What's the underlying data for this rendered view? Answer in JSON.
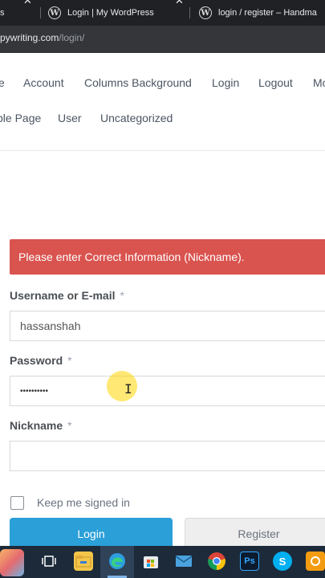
{
  "browser": {
    "tabs": [
      {
        "label": "s"
      },
      {
        "label": "Login | My WordPress"
      },
      {
        "label": "login / register – Handma"
      }
    ],
    "url_host": "pywriting.com",
    "url_path": "/login/"
  },
  "nav": {
    "row1": [
      "e",
      "Account",
      "Columns Background",
      "Login",
      "Logout",
      "Mo"
    ],
    "row2": [
      "ble Page",
      "User",
      "Uncategorized"
    ]
  },
  "alert": {
    "message": "Please enter Correct Information (Nickname).",
    "color": "#d9534f"
  },
  "form": {
    "username_label": "Username or E-mail",
    "username_value": "hassanshah",
    "password_label": "Password",
    "password_value": "••••••••••",
    "nickname_label": "Nickname",
    "nickname_value": "",
    "required_mark": "*",
    "keep_signed_in_label": "Keep me signed in",
    "keep_signed_in_checked": false,
    "login_button": "Login",
    "register_button": "Register"
  },
  "taskbar": {
    "apps": [
      "paint-icon",
      "task-view-icon",
      "file-explorer-icon",
      "edge-icon",
      "store-icon",
      "mail-icon",
      "chrome-icon",
      "photoshop-icon",
      "skype-icon",
      "app-icon"
    ],
    "photoshop_label": "Ps",
    "skype_label": "S"
  },
  "colors": {
    "primary_button": "#2a9fd8",
    "alert": "#d9534f",
    "taskbar": "#1c2a3a"
  }
}
